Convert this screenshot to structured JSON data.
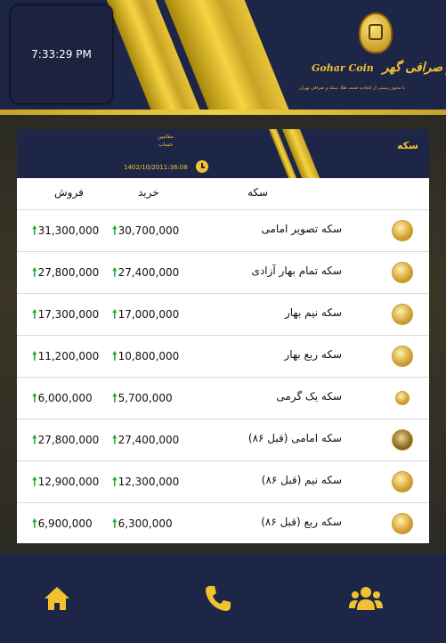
{
  "header": {
    "clock": "7:33:29 PM",
    "brand_en": "Gohar Coin",
    "brand_fa": "سکه و صرافی گهر",
    "subtitle": "با مجوز رسمی از اتحادیه صنف طلا، سکه و صرافی تهران"
  },
  "panel": {
    "title": "سکه",
    "units_line1": "مقاتیین",
    "units_line2": "حساب",
    "datetime": "1402/10/2011:36:08",
    "columns": {
      "name": "سکه",
      "buy": "خرید",
      "sell": "فروش"
    }
  },
  "rows": [
    {
      "name": "سکه تصویر امامی",
      "buy": "30,700,000",
      "sell": "31,300,000"
    },
    {
      "name": "سکه تمام بهار آزادی",
      "buy": "27,400,000",
      "sell": "27,800,000"
    },
    {
      "name": "سکه نیم بهار",
      "buy": "17,000,000",
      "sell": "17,300,000"
    },
    {
      "name": "سکه ربع بهار",
      "buy": "10,800,000",
      "sell": "11,200,000"
    },
    {
      "name": "سکه یک گرمی",
      "buy": "5,700,000",
      "sell": "6,000,000"
    },
    {
      "name": "سکه امامی (قبل ۸۶)",
      "buy": "27,400,000",
      "sell": "27,800,000"
    },
    {
      "name": "سکه نیم (قبل ۸۶)",
      "buy": "12,300,000",
      "sell": "12,900,000"
    },
    {
      "name": "سکه ربع (قبل ۸۶)",
      "buy": "6,300,000",
      "sell": "6,900,000"
    }
  ],
  "footer": {
    "icons": [
      "home-icon",
      "phone-icon",
      "users-icon"
    ]
  },
  "colors": {
    "navy": "#1e2647",
    "gold": "#f2c230",
    "up_arrow": "#1faa2b"
  }
}
